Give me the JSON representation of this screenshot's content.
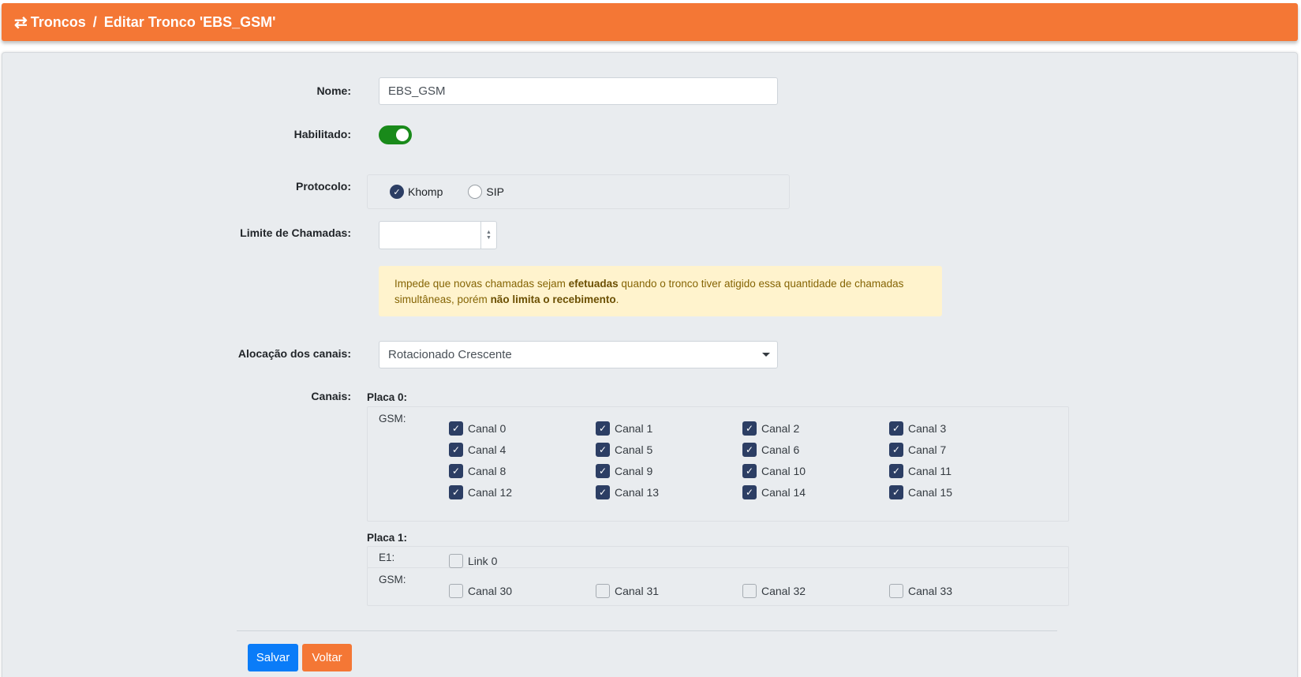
{
  "header": {
    "icon": "arrows-exchange-icon",
    "breadcrumb_root": "Troncos",
    "separator": "/",
    "breadcrumb_current": "Editar Tronco 'EBS_GSM'"
  },
  "form": {
    "nome_label": "Nome:",
    "nome_value": "EBS_GSM",
    "habilitado_label": "Habilitado:",
    "habilitado_on": true,
    "protocolo_label": "Protocolo:",
    "protocolo_options": [
      "Khomp",
      "SIP"
    ],
    "protocolo_selected": "Khomp",
    "limite_label": "Limite de Chamadas:",
    "limite_value": "",
    "alert_text_1": "Impede que novas chamadas sejam ",
    "alert_bold_1": "efetuadas",
    "alert_text_2": " quando o tronco tiver atigido essa quantidade de chamadas simultâneas, porém ",
    "alert_bold_2": "não limita o recebimento",
    "alert_text_3": ".",
    "alocacao_label": "Alocação dos canais:",
    "alocacao_value": "Rotacionado Crescente",
    "canais_label": "Canais:"
  },
  "placas": [
    {
      "title": "Placa 0:",
      "groups": [
        {
          "label": "GSM:",
          "channels": [
            {
              "label": "Canal 0",
              "checked": true
            },
            {
              "label": "Canal 1",
              "checked": true
            },
            {
              "label": "Canal 2",
              "checked": true
            },
            {
              "label": "Canal 3",
              "checked": true
            },
            {
              "label": "Canal 4",
              "checked": true
            },
            {
              "label": "Canal 5",
              "checked": true
            },
            {
              "label": "Canal 6",
              "checked": true
            },
            {
              "label": "Canal 7",
              "checked": true
            },
            {
              "label": "Canal 8",
              "checked": true
            },
            {
              "label": "Canal 9",
              "checked": true
            },
            {
              "label": "Canal 10",
              "checked": true
            },
            {
              "label": "Canal 11",
              "checked": true
            },
            {
              "label": "Canal 12",
              "checked": true
            },
            {
              "label": "Canal 13",
              "checked": true
            },
            {
              "label": "Canal 14",
              "checked": true
            },
            {
              "label": "Canal 15",
              "checked": true
            }
          ]
        }
      ]
    },
    {
      "title": "Placa 1:",
      "groups": [
        {
          "label": "E1:",
          "channels": [
            {
              "label": "Link 0",
              "checked": false
            }
          ]
        },
        {
          "label": "GSM:",
          "channels": [
            {
              "label": "Canal 30",
              "checked": false
            },
            {
              "label": "Canal 31",
              "checked": false
            },
            {
              "label": "Canal 32",
              "checked": false
            },
            {
              "label": "Canal 33",
              "checked": false
            }
          ]
        }
      ]
    }
  ],
  "buttons": {
    "save": "Salvar",
    "back": "Voltar"
  },
  "colors": {
    "header": "#f47735",
    "toggle_on": "#198a1a",
    "checkbox_checked": "#2c3e64",
    "save_button": "#0a7cf8",
    "back_button": "#f47735",
    "alert_bg": "#fff3cd"
  }
}
